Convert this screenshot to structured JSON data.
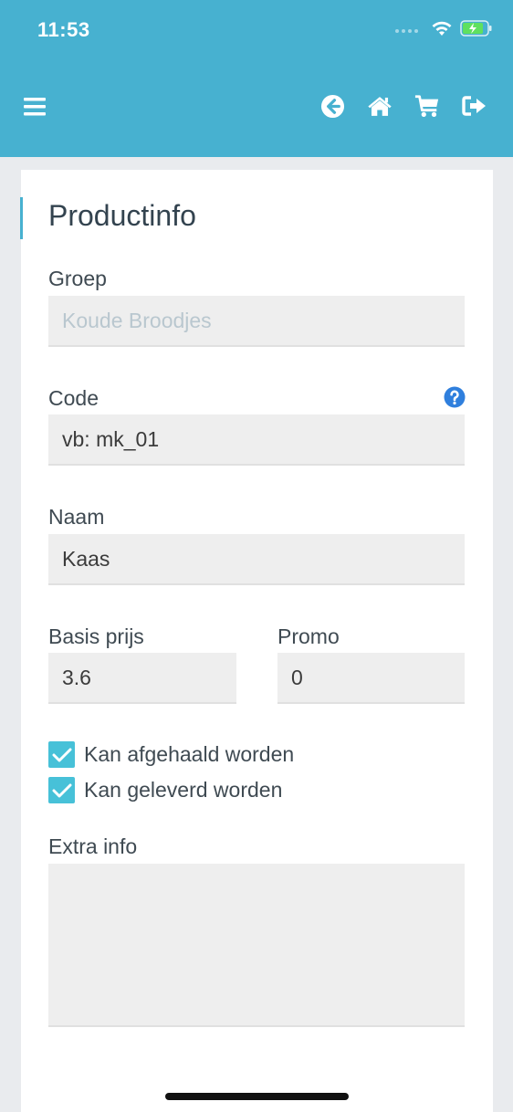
{
  "status": {
    "time": "11:53"
  },
  "colors": {
    "brand": "#47b1d0",
    "checkbox": "#47c1d8",
    "help": "#2f7fdd"
  },
  "nav": {
    "menu_icon": "hamburger-icon",
    "icons": [
      "back-arrow-icon",
      "home-icon",
      "cart-icon",
      "logout-icon"
    ]
  },
  "form": {
    "title": "Productinfo",
    "groep": {
      "label": "Groep",
      "value": "Koude Broodjes"
    },
    "code": {
      "label": "Code",
      "placeholder": "vb: mk_01"
    },
    "naam": {
      "label": "Naam",
      "value": "Kaas"
    },
    "basis_prijs": {
      "label": "Basis prijs",
      "value": "3.6"
    },
    "promo": {
      "label": "Promo",
      "value": "0"
    },
    "afhalen": {
      "label": "Kan afgehaald worden",
      "checked": true
    },
    "leveren": {
      "label": "Kan geleverd worden",
      "checked": true
    },
    "extra_info": {
      "label": "Extra info",
      "value": ""
    }
  }
}
